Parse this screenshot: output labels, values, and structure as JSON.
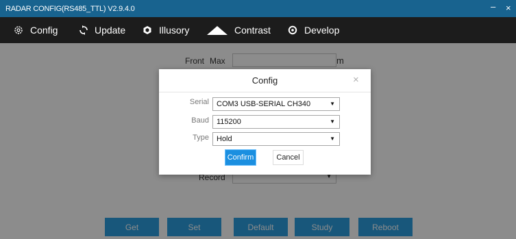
{
  "window": {
    "title": "RADAR CONFIG(RS485_TTL) V2.9.4.0",
    "minimize_glyph": "–",
    "close_glyph": "×"
  },
  "menu": {
    "items": [
      {
        "label": "Config",
        "icon": "gear-icon"
      },
      {
        "label": "Update",
        "icon": "refresh-icon"
      },
      {
        "label": "Illusory",
        "icon": "hexagon-icon"
      },
      {
        "label": "Contrast",
        "icon": "mountain-icon"
      },
      {
        "label": "Develop",
        "icon": "settings-icon"
      }
    ]
  },
  "form": {
    "front_label": "Front",
    "max_label": "Max",
    "max_value": "",
    "unit": "m",
    "record_label": "Record",
    "record_value": ""
  },
  "buttons": {
    "get": "Get",
    "set": "Set",
    "default": "Default",
    "study": "Study",
    "reboot": "Reboot"
  },
  "dialog": {
    "title": "Config",
    "close_glyph": "×",
    "serial_label": "Serial",
    "serial_value": "COM3  USB-SERIAL CH340",
    "baud_label": "Baud",
    "baud_value": "115200",
    "type_label": "Type",
    "type_value": "Hold",
    "confirm_label": "Confirm",
    "cancel_label": "Cancel"
  },
  "colors": {
    "titlebar": "#18638f",
    "menubar": "#1c1c1c",
    "button_blue": "#2d9fe0",
    "confirm_blue": "#1b8fe0"
  }
}
